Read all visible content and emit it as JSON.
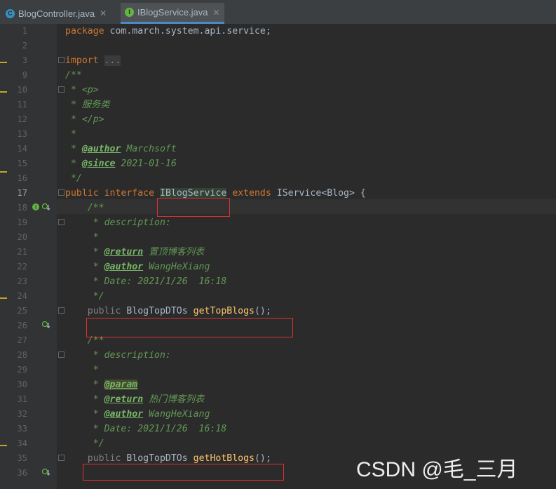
{
  "tabs": [
    {
      "label": "BlogController.java",
      "icon": "class-c-icon",
      "active": false
    },
    {
      "label": "IBlogService.java",
      "icon": "interface-i-icon",
      "active": true
    }
  ],
  "lines": [
    {
      "n": "1",
      "html": "<span class='kw'>package</span> com.march.system.api.service;"
    },
    {
      "n": "2",
      "html": ""
    },
    {
      "n": "3",
      "html": "<span class='kw'>import</span> <span class='gray' style='background:#3b3b3b'>...</span>"
    },
    {
      "n": "9",
      "html": "<span class='doc'>/**</span>"
    },
    {
      "n": "10",
      "html": "<span class='doc'> * &lt;p&gt;</span>"
    },
    {
      "n": "11",
      "html": "<span class='doc'> * 服务类</span>"
    },
    {
      "n": "12",
      "html": "<span class='doc'> * &lt;/p&gt;</span>"
    },
    {
      "n": "13",
      "html": "<span class='doc'> *</span>"
    },
    {
      "n": "14",
      "html": "<span class='doc'> * <span class='tag'>@author</span> Marchsoft</span>"
    },
    {
      "n": "15",
      "html": "<span class='doc'> * <span class='tag'>@since</span> 2021-01-16</span>"
    },
    {
      "n": "16",
      "html": "<span class='doc'> */</span>"
    },
    {
      "n": "17",
      "html": "<span class='kw'>public interface</span> <span class='sel'>IBlogService</span> <span class='kw'>extends</span> IService&lt;Blog&gt; {"
    },
    {
      "n": "18",
      "html": "    <span class='doc'>/**</span>"
    },
    {
      "n": "19",
      "html": "<span class='doc'>     * description:</span>"
    },
    {
      "n": "20",
      "html": "<span class='doc'>     *</span>"
    },
    {
      "n": "21",
      "html": "<span class='doc'>     * <span class='tag'>@return</span> 置顶博客列表</span>"
    },
    {
      "n": "22",
      "html": "<span class='doc'>     * <span class='tag'>@author</span> WangHeXiang</span>"
    },
    {
      "n": "23",
      "html": "<span class='doc'>     * Date: 2021/1/26  16:18</span>"
    },
    {
      "n": "24",
      "html": "<span class='doc'>     */</span>"
    },
    {
      "n": "25",
      "html": "    <span class='gray'>public</span> BlogTopDTOs <span class='fn'>getTopBlogs</span>();"
    },
    {
      "n": "26",
      "html": ""
    },
    {
      "n": "27",
      "html": "    <span class='doc'>/**</span>"
    },
    {
      "n": "28",
      "html": "<span class='doc'>     * description:</span>"
    },
    {
      "n": "29",
      "html": "<span class='doc'>     *</span>"
    },
    {
      "n": "30",
      "html": "<span class='doc'>     * <span class='tag tagbg'>@param</span></span>"
    },
    {
      "n": "31",
      "html": "<span class='doc'>     * <span class='tag'>@return</span> 热门博客列表</span>"
    },
    {
      "n": "32",
      "html": "<span class='doc'>     * <span class='tag'>@author</span> WangHeXiang</span>"
    },
    {
      "n": "33",
      "html": "<span class='doc'>     * Date: 2021/1/26  16:18</span>"
    },
    {
      "n": "34",
      "html": "<span class='doc'>     */</span>"
    },
    {
      "n": "35",
      "html": "    <span class='gray'>public</span> BlogTopDTOs <span class='fn'>getHotBlogs</span>();"
    },
    {
      "n": "36",
      "html": ""
    }
  ],
  "watermark": "CSDN @毛_三月",
  "colors": {
    "keyword": "#cc7832",
    "doc": "#629755",
    "method": "#ffc66d",
    "highlight_box": "#e0302f"
  }
}
